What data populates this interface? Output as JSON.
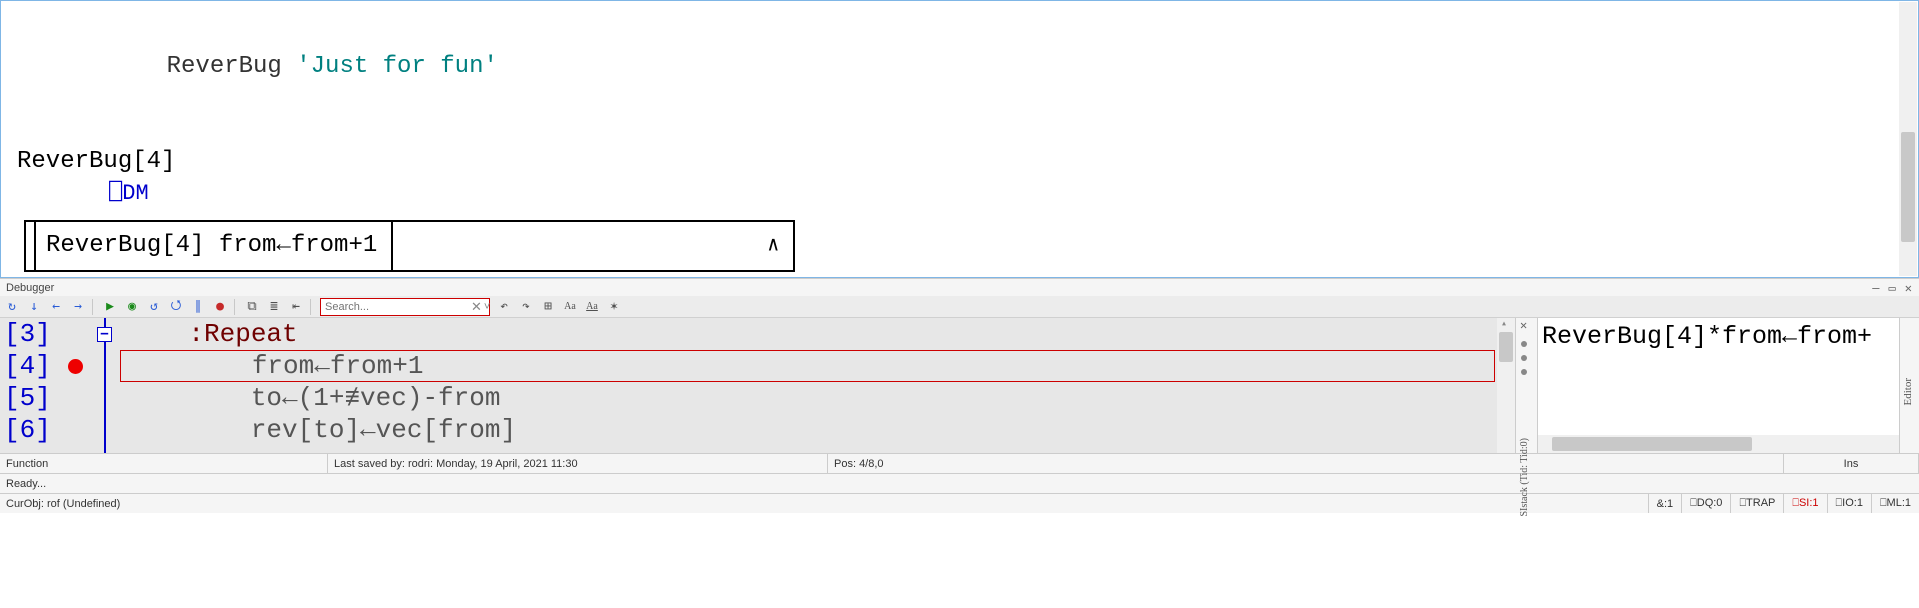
{
  "session": {
    "call_fn": "ReverBug",
    "call_arg": "'Just for fun'",
    "head": "ReverBug[4]",
    "dm": "⎕DM",
    "box_cell1": "ReverBug[4] from←from+1",
    "box_cell2_width": 400,
    "box_caret": "∧"
  },
  "debugger": {
    "title": "Debugger",
    "window_buttons": {
      "min": "—",
      "max": "▭",
      "close": "✕"
    },
    "search": {
      "placeholder": "Search...",
      "clear": "✕",
      "dropdown": "˅"
    },
    "toolbar_icons": [
      "rewind",
      "step-down",
      "step-back",
      "step-forward",
      "sep",
      "run",
      "run-to",
      "restart",
      "stop",
      "pause",
      "breakpoint-toggle",
      "sep",
      "outline-1",
      "outline-2",
      "outdent",
      "sep",
      "search",
      "sep",
      "find-prev",
      "find-next",
      "expand",
      "Aa",
      "Aa-u",
      "star"
    ],
    "code": {
      "lines": [
        {
          "num": "[3]",
          "bp": false,
          "text_pre": "    ",
          "kw": ":Repeat",
          "text_post": ""
        },
        {
          "num": "[4]",
          "bp": true,
          "text_pre": "        ",
          "kw": "",
          "text_post": "from←from+1"
        },
        {
          "num": "[5]",
          "bp": false,
          "text_pre": "        ",
          "kw": "",
          "text_post": "to←(1+≢vec)-from"
        },
        {
          "num": "[6]",
          "bp": false,
          "text_pre": "        ",
          "kw": "",
          "text_post": "rev[to]←vec[from]"
        }
      ],
      "fold_symbol": "−"
    },
    "sistack": {
      "title": "SIstack (Tid: Tid:0)",
      "close": "✕"
    },
    "right": {
      "expr": "ReverBug[4]*from←from+"
    },
    "editor_tab": "Editor"
  },
  "footer1": {
    "function": "Function",
    "saved": "Last saved by: rodri: Monday, 19 April, 2021 11:30",
    "pos": "Pos: 4/8,0",
    "ins": "Ins"
  },
  "footer2": {
    "ready": "Ready..."
  },
  "footer3": {
    "curobj": "CurObj: rof (Undefined)",
    "stats": [
      {
        "k": "&:1",
        "red": false
      },
      {
        "k": "⎕DQ:0",
        "red": false
      },
      {
        "k": "⎕TRAP",
        "red": false
      },
      {
        "k": "⎕SI:1",
        "red": true
      },
      {
        "k": "⎕IO:1",
        "red": false
      },
      {
        "k": "⎕ML:1",
        "red": false
      }
    ]
  }
}
